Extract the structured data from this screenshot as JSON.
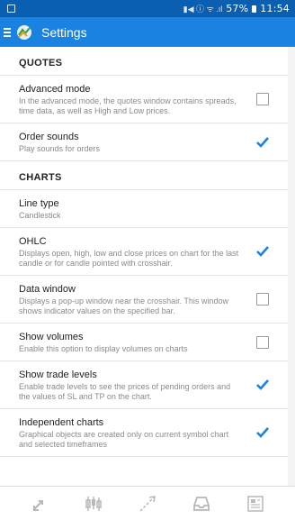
{
  "status_bar": {
    "signal_text": "▮◀ ⓘ ᯤ .ıl",
    "battery": "57%",
    "time": "11:54"
  },
  "app_bar": {
    "title": "Settings"
  },
  "sections": [
    {
      "header": "QUOTES",
      "items": [
        {
          "title": "Advanced mode",
          "subtitle": "In the advanced mode, the quotes window contains spreads, time data, as well as High and Low prices.",
          "checked": false
        },
        {
          "title": "Order sounds",
          "subtitle": "Play sounds for orders",
          "checked": true
        }
      ]
    },
    {
      "header": "CHARTS",
      "items": [
        {
          "title": "Line type",
          "subtitle": "Candlestick",
          "checked": null
        },
        {
          "title": "OHLC",
          "subtitle": "Displays open, high, low and close prices on chart for the last candle or for candle pointed with crosshair.",
          "checked": true
        },
        {
          "title": "Data window",
          "subtitle": "Displays a pop-up window near the crosshair. This window shows indicator values on the specified bar.",
          "checked": false
        },
        {
          "title": "Show volumes",
          "subtitle": "Enable this option to display volumes on charts",
          "checked": false
        },
        {
          "title": "Show trade levels",
          "subtitle": "Enable trade levels to see the prices of pending orders and the values of SL and TP on the chart.",
          "checked": true
        },
        {
          "title": "Independent charts",
          "subtitle": "Graphical objects are created only on current symbol chart and selected timeframes",
          "checked": true
        }
      ]
    }
  ],
  "bottom_nav": [
    {
      "name": "quotes-nav",
      "icon": "quotes-arrows-icon"
    },
    {
      "name": "chart-nav",
      "icon": "candles-icon"
    },
    {
      "name": "trade-nav",
      "icon": "trade-line-icon"
    },
    {
      "name": "history-nav",
      "icon": "inbox-icon"
    },
    {
      "name": "news-nav",
      "icon": "newspaper-icon"
    }
  ],
  "colors": {
    "status_bar": "#0a5fb0",
    "app_bar": "#1a82e0",
    "check_accent": "#1a82e0",
    "nav_icon": "#b8b8b8"
  }
}
